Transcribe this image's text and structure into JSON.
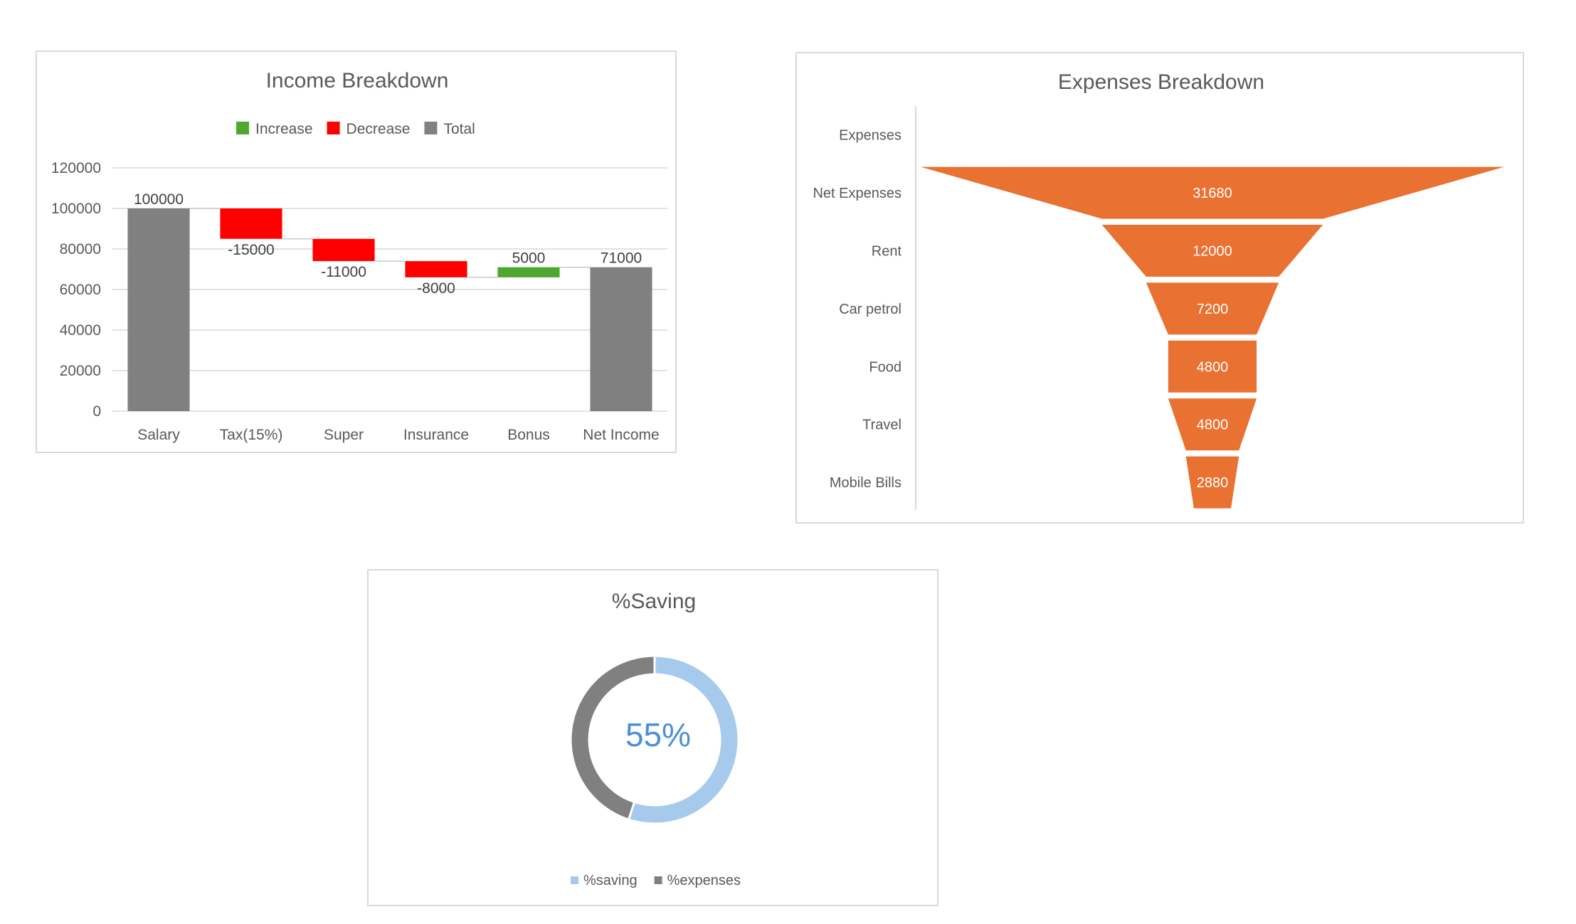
{
  "chart_data": [
    {
      "type": "bar",
      "subtype": "waterfall",
      "title": "Income Breakdown",
      "categories": [
        "Salary",
        "Tax(15%)",
        "Super",
        "Insurance",
        "Bonus",
        "Net Income"
      ],
      "values": [
        100000,
        -15000,
        -11000,
        -8000,
        5000,
        71000
      ],
      "value_labels": [
        "100000",
        "-15000",
        "-11000",
        "-8000",
        "5000",
        "71000"
      ],
      "kinds": [
        "total",
        "decrease",
        "decrease",
        "decrease",
        "increase",
        "total"
      ],
      "legend": [
        {
          "name": "Increase",
          "color": "#4ea72e"
        },
        {
          "name": "Decrease",
          "color": "#ff0000"
        },
        {
          "name": "Total",
          "color": "#808080"
        }
      ],
      "legend_position": "top",
      "ylim": [
        0,
        120000
      ],
      "yticks": [
        "0",
        "20000",
        "40000",
        "60000",
        "80000",
        "100000",
        "120000"
      ],
      "grid": true,
      "xlabel": "",
      "ylabel": ""
    },
    {
      "type": "bar",
      "subtype": "funnel",
      "title": "Expenses Breakdown",
      "categories": [
        "Expenses",
        "Net Expenses",
        "Rent",
        "Car petrol",
        "Food",
        "Travel",
        "Mobile Bills"
      ],
      "values": [
        null,
        31680,
        12000,
        7200,
        4800,
        4800,
        2880
      ],
      "value_labels": [
        "",
        "31680",
        "12000",
        "7200",
        "4800",
        "4800",
        "2880"
      ],
      "color": "#e97132",
      "grid": false
    },
    {
      "type": "pie",
      "subtype": "doughnut",
      "title": "%Saving",
      "center_label": "55%",
      "slices": [
        {
          "name": "%saving",
          "value": 55,
          "color": "#a6caec"
        },
        {
          "name": "%expenses",
          "value": 45,
          "color": "#808080"
        }
      ],
      "legend_position": "bottom"
    }
  ]
}
